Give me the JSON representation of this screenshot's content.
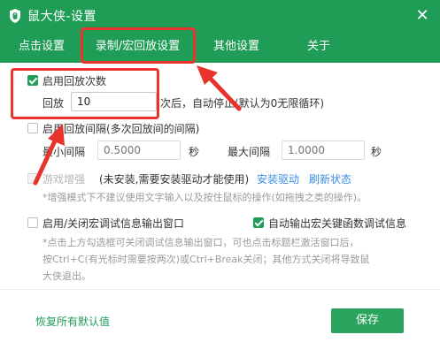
{
  "titlebar": {
    "title": "鼠大侠-设置",
    "close_icon": "close-icon",
    "logo_icon": "mouse-shield-logo"
  },
  "tabs": [
    {
      "label": "点击设置",
      "active": false
    },
    {
      "label": "录制/宏回放设置",
      "active": true
    },
    {
      "label": "其他设置",
      "active": false
    },
    {
      "label": "关于",
      "active": false
    }
  ],
  "replay_count": {
    "checkbox_label": "启用回放次数",
    "checked": true,
    "count_label": "回放",
    "count_value": "10",
    "count_suffix": "次后，自动停止(默认为0无限循环)"
  },
  "replay_interval": {
    "checkbox_label": "启用回放间隔(多次回放间的间隔)",
    "checked": false,
    "min_label": "最小间隔",
    "min_placeholder": "0.5000",
    "min_unit": "秒",
    "max_label": "最大间隔",
    "max_placeholder": "1.0000",
    "max_unit": "秒"
  },
  "game_enhance": {
    "checkbox_label": "游戏增强",
    "status": "(未安装,需要安装驱动才能使用)",
    "install_link": "安装驱动",
    "refresh_link": "刷新状态",
    "note": "*增强模式下不建议使用文字输入以及按住鼠标的操作(如拖拽之类的操作)。"
  },
  "debug_window": {
    "checkbox_label": "启用/关闭宏调试信息输出窗口",
    "checked": false,
    "auto_output_label": "自动输出宏关键函数调试信息",
    "auto_output_checked": true,
    "note_line1": "*点击上方勾选框可关闭调试信息输出窗口，可也点击标题栏激活窗口后，",
    "note_line2": "按Ctrl+C(有光标时需要按两次)或Ctrl+Break关闭；其他方式关闭将导致鼠",
    "note_line3": "大侠退出。"
  },
  "footer": {
    "restore_defaults": "恢复所有默认值",
    "save": "保存"
  },
  "colors": {
    "brand_green": "#1f9d57",
    "annotation_red": "#e8322c",
    "link_blue": "#3a8ee6"
  }
}
